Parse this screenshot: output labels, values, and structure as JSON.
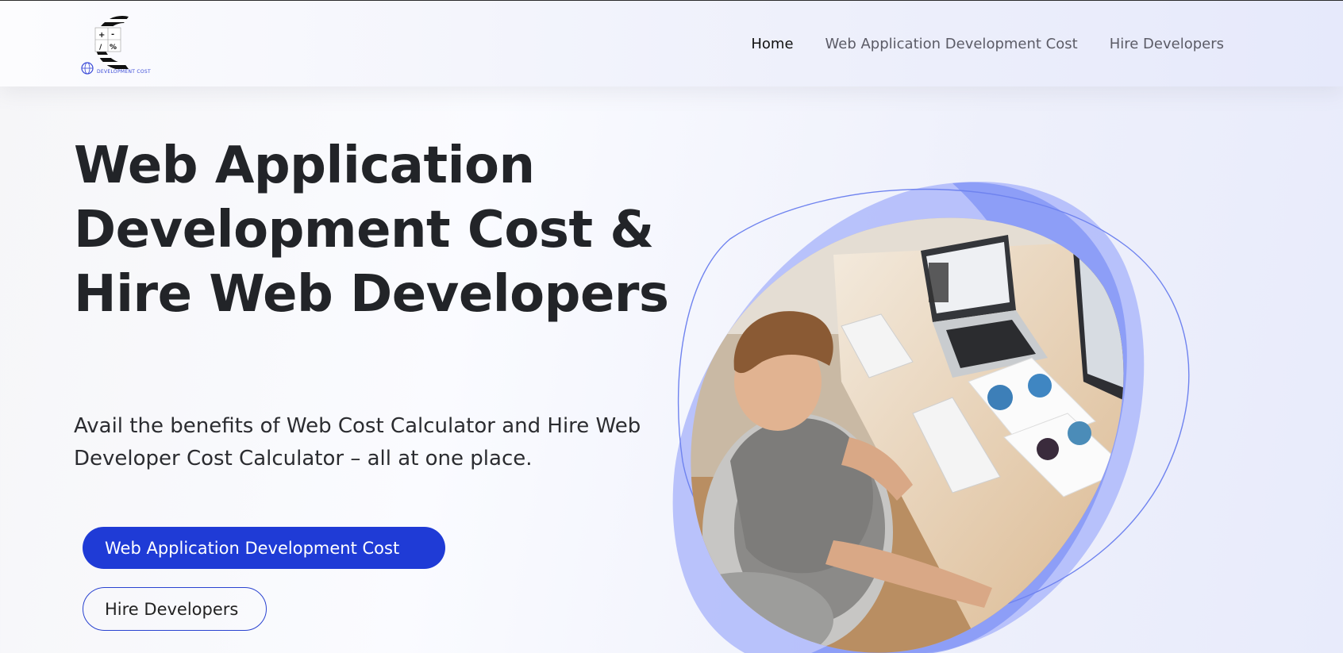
{
  "header": {
    "logo": {
      "caption": "DEVELOPMENT COST",
      "glyphs": [
        "+",
        "-",
        "/",
        "%"
      ]
    },
    "nav": [
      {
        "label": "Home",
        "active": true
      },
      {
        "label": "Web Application Development Cost",
        "active": false
      },
      {
        "label": "Hire Developers",
        "active": false
      }
    ]
  },
  "hero": {
    "title": "Web Application Development Cost & Hire Web Developers",
    "subtitle": "Avail the benefits of Web Cost Calculator and Hire Web Developer Cost Calculator – all at one place.",
    "primary_button": "Web Application Development Cost",
    "secondary_button": "Hire Developers",
    "image": "developer-working-at-desk-photo"
  },
  "colors": {
    "brand_blue": "#1f3bd6",
    "blob_blue": "#7b8ef5",
    "text_dark": "#222428"
  }
}
